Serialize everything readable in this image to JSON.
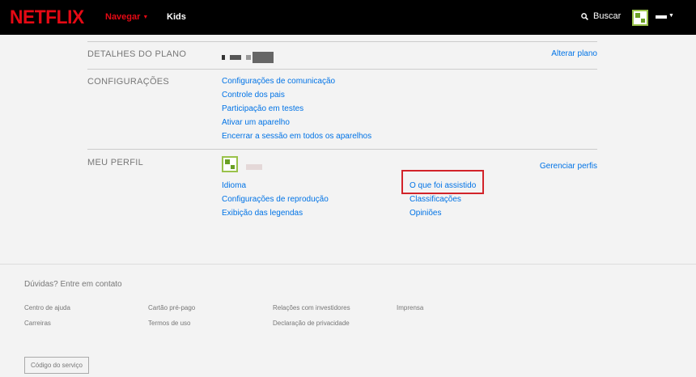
{
  "header": {
    "logo": "NETFLIX",
    "nav_browse": "Navegar",
    "nav_kids": "Kids",
    "search_label": "Buscar"
  },
  "plan": {
    "label": "DETALHES DO PLANO",
    "action": "Alterar plano"
  },
  "settings": {
    "label": "CONFIGURAÇÕES",
    "links": [
      "Configurações de comunicação",
      "Controle dos pais",
      "Participação em testes",
      "Ativar um aparelho",
      "Encerrar a sessão em todos os aparelhos"
    ]
  },
  "profile": {
    "label": "MEU PERFIL",
    "action": "Gerenciar perfis",
    "left_links": [
      "Idioma",
      "Configurações de reprodução",
      "Exibição das legendas"
    ],
    "right_links": [
      "O que foi assistido",
      "Classificações",
      "Opiniões"
    ]
  },
  "footer": {
    "title": "Dúvidas? Entre em contato",
    "links": [
      "Centro de ajuda",
      "Cartão pré-pago",
      "Relações com investidores",
      "Imprensa",
      "Carreiras",
      "Termos de uso",
      "Declaração de privacidade"
    ],
    "service_code": "Código do serviço"
  },
  "colors": {
    "brand": "#e50914",
    "link": "#0073e6",
    "highlight": "#d2232a"
  }
}
